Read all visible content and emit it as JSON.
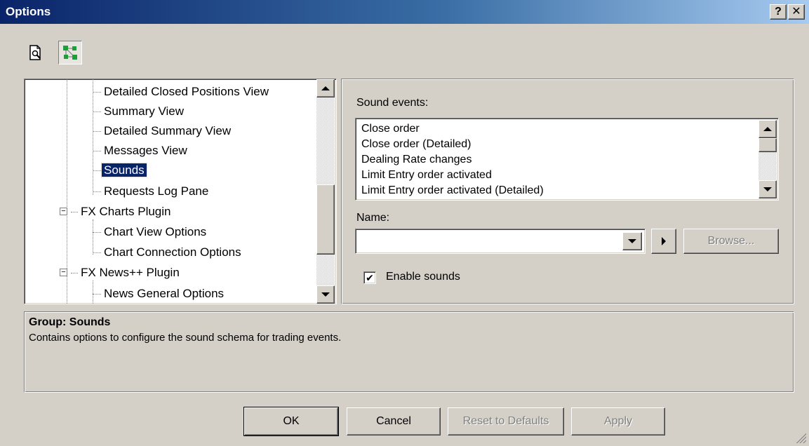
{
  "window": {
    "title": "Options",
    "help_glyph": "?",
    "close_glyph": "✕"
  },
  "toolbar": {
    "icons": [
      "page-preview-icon",
      "tree-view-icon"
    ]
  },
  "tree": {
    "items": [
      {
        "label": "Detailed Closed Positions View",
        "level": 2
      },
      {
        "label": "Summary View",
        "level": 2
      },
      {
        "label": "Detailed Summary View",
        "level": 2
      },
      {
        "label": "Messages View",
        "level": 2
      },
      {
        "label": "Sounds",
        "level": 2,
        "selected": true
      },
      {
        "label": "Requests Log Pane",
        "level": 2
      },
      {
        "label": "FX Charts Plugin",
        "level": 1,
        "expander": "−"
      },
      {
        "label": "Chart View Options",
        "level": 2
      },
      {
        "label": "Chart Connection Options",
        "level": 2
      },
      {
        "label": "FX News++ Plugin",
        "level": 1,
        "expander": "−"
      },
      {
        "label": "News General Options",
        "level": 2
      }
    ]
  },
  "sound_panel": {
    "events_label": "Sound events:",
    "events": [
      "Close order",
      "Close order (Detailed)",
      "Dealing Rate changes",
      "Limit Entry order activated",
      "Limit Entry order activated (Detailed)"
    ],
    "name_label": "Name:",
    "name_value": "",
    "browse_label": "Browse...",
    "enable_label": "Enable sounds",
    "enable_checked": true,
    "check_glyph": "✔"
  },
  "description": {
    "title": "Group: Sounds",
    "text": "Contains options to configure the sound schema for trading events."
  },
  "buttons": {
    "ok": "OK",
    "cancel": "Cancel",
    "reset": "Reset to Defaults",
    "apply": "Apply"
  },
  "colors": {
    "title_gradient_start": "#0a246a",
    "title_gradient_end": "#a6caf0",
    "selection": "#0a246a",
    "face": "#d4d0c8"
  }
}
